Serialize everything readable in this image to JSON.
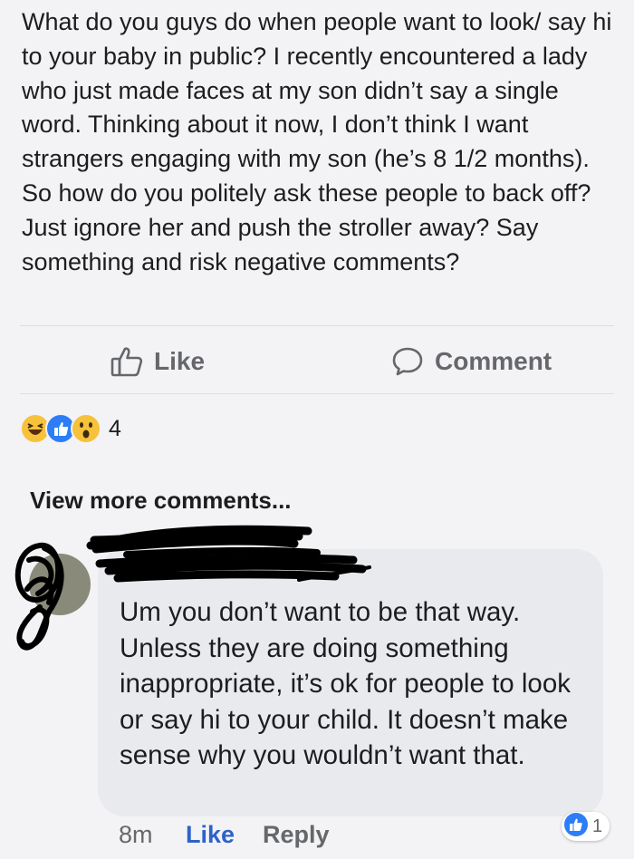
{
  "post": {
    "text": "What do you guys do when people want to look/ say hi to your baby in public? I recently encountered a lady who just made faces at my son didn’t say a single word. Thinking about it now, I don’t think I want strangers engaging with my son (he’s 8 1/2 months). So how do you politely ask these people to back off? Just ignore her and push the stroller away? Say something and risk negative comments?"
  },
  "actions": {
    "like_label": "Like",
    "comment_label": "Comment"
  },
  "reactions": {
    "icons": [
      "haha-icon",
      "like-icon",
      "wow-icon"
    ],
    "count": "4"
  },
  "comments": {
    "view_more": "View more comments...",
    "items": [
      {
        "text": "Um you don’t want to be that way. Unless they are doing something inappropriate, it’s ok for people to look or say hi to your child. It doesn’t make sense why you wouldn’t want that.",
        "time": "8m",
        "like_label": "Like",
        "reply_label": "Reply",
        "reaction_count": "1"
      }
    ]
  },
  "colors": {
    "accent": "#2d63c8",
    "bubble": "#e8eaee",
    "muted": "#65676b",
    "background": "#f3f3f5"
  }
}
